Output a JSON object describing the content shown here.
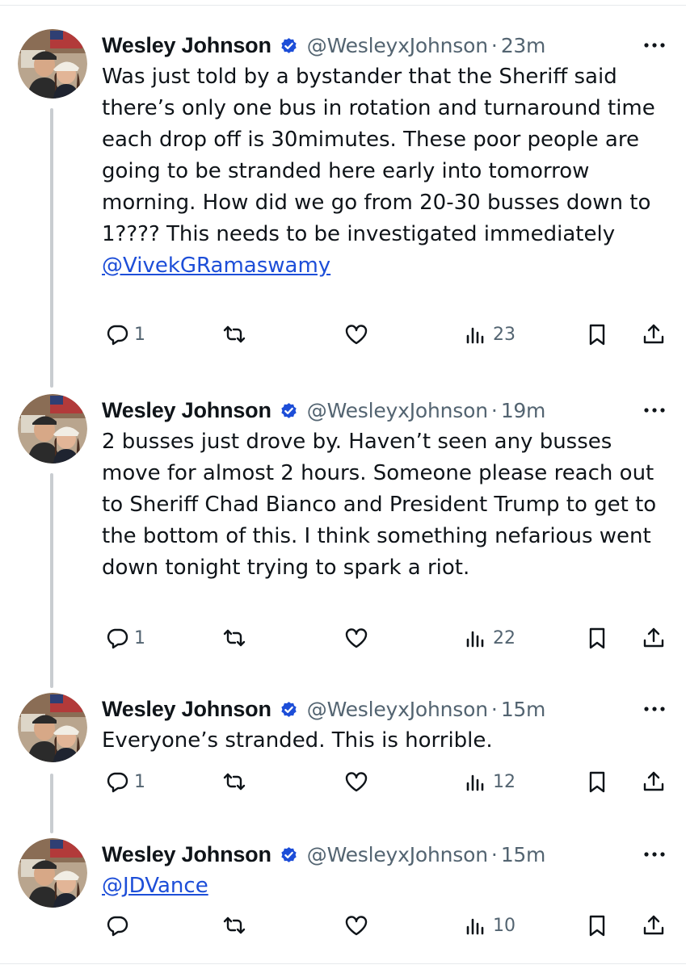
{
  "user": {
    "name": "Wesley Johnson",
    "handle": "@WesleyxJohnson",
    "separator": "·"
  },
  "tweets": [
    {
      "time": "23m",
      "text": "Was just told by a bystander that the Sheriff said there’s only one bus in rotation and turnaround time each drop off is 30mimutes. These poor people are going to be stranded here early into tomorrow morning. How did we go from 20-30 busses down to 1???? This needs to be investigated immediately ",
      "mention": "@VivekGRamaswamy",
      "replies": "1",
      "retweets": "",
      "likes": "",
      "views": "23"
    },
    {
      "time": "19m",
      "text": "2 busses just drove by. Haven’t seen any busses move for almost 2 hours. Someone please reach out to Sheriff Chad Bianco and President Trump to get to the bottom of this. I think something nefarious went down tonight trying to spark a riot.",
      "mention": "",
      "replies": "1",
      "retweets": "",
      "likes": "",
      "views": "22"
    },
    {
      "time": "15m",
      "text": "Everyone’s stranded. This is horrible.",
      "mention": "",
      "replies": "1",
      "retweets": "",
      "likes": "",
      "views": "12"
    },
    {
      "time": "15m",
      "text": "",
      "mention": "@JDVance",
      "replies": "",
      "retweets": "",
      "likes": "",
      "views": "10"
    }
  ],
  "icons": {
    "verified": "verified-badge-icon",
    "more": "more-horizontal-icon",
    "reply": "reply-icon",
    "retweet": "retweet-icon",
    "like": "heart-icon",
    "views": "views-chart-icon",
    "bookmark": "bookmark-icon",
    "share": "share-icon"
  },
  "colors": {
    "text": "#0f1419",
    "secondary": "#536471",
    "mention": "#1d4ed8",
    "verified": "#1d4ed8",
    "thread_line": "#c9cdd1"
  }
}
